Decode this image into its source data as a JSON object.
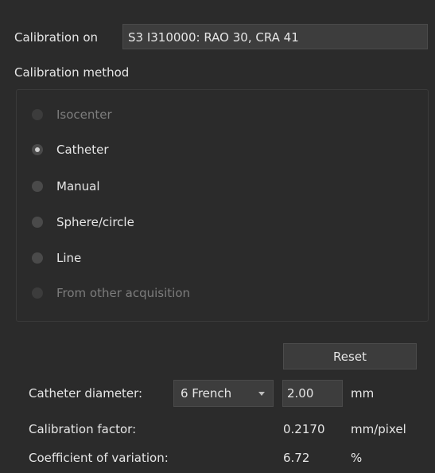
{
  "calibration_on": {
    "label": "Calibration on",
    "value": "S3 I310000: RAO 30, CRA 41"
  },
  "calibration_method": {
    "label": "Calibration method",
    "options": [
      {
        "label": "Isocenter",
        "selected": false,
        "enabled": false
      },
      {
        "label": "Catheter",
        "selected": true,
        "enabled": true
      },
      {
        "label": "Manual",
        "selected": false,
        "enabled": true
      },
      {
        "label": "Sphere/circle",
        "selected": false,
        "enabled": true
      },
      {
        "label": "Line",
        "selected": false,
        "enabled": true
      },
      {
        "label": "From other acquisition",
        "selected": false,
        "enabled": false
      }
    ]
  },
  "reset_button": {
    "label": "Reset"
  },
  "catheter_diameter": {
    "label": "Catheter diameter:",
    "size_selected": "6 French",
    "value": "2.00",
    "unit": "mm"
  },
  "calibration_factor": {
    "label": "Calibration factor:",
    "value": "0.2170",
    "unit": "mm/pixel"
  },
  "coefficient_of_variation": {
    "label": "Coefficient of variation:",
    "value": "6.72",
    "unit": "%"
  },
  "colors": {
    "background": "#2b2b2b",
    "field": "#3d3d3d",
    "text": "#e6e6e6",
    "disabled_text": "#7d7d7d"
  }
}
